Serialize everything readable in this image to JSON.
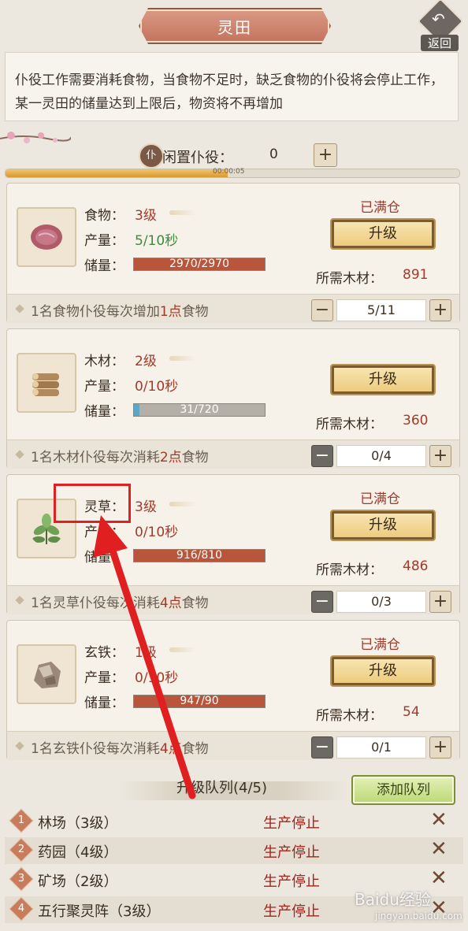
{
  "header": {
    "title": "灵田",
    "back_label": "返回"
  },
  "description": "仆役工作需要消耗食物，当食物不足时，缺乏食物的仆役将会停止工作，某一灵田的储量达到上限后，物资将不再增加",
  "idle": {
    "label": "闲置仆役：",
    "value": "0",
    "plus": "+",
    "icon_text": "仆",
    "timer": "00:00:05",
    "timer_progress": 0.49
  },
  "labels": {
    "rate": "产量：",
    "storage": "储量：",
    "cost": "所需木材：",
    "upgrade": "升级",
    "full": "已满仓",
    "minus": "−",
    "plus": "+"
  },
  "cards": [
    {
      "name": "食物：",
      "level": "3级",
      "rate": "5/10秒",
      "storage_text": "2970/2970",
      "storage_fill": 1.0,
      "full": true,
      "cost": "891",
      "footer_pre": "1名食物仆役每次增加",
      "footer_num": "1点",
      "footer_post": "食物",
      "count": "5/11",
      "icon": "meat-icon"
    },
    {
      "name": "木材：",
      "level": "2级",
      "rate": "0/10秒",
      "storage_text": "31/720",
      "storage_fill": 0.04,
      "full": false,
      "cost": "360",
      "footer_pre": "1名木材仆役每次消耗",
      "footer_num": "2点",
      "footer_post": "食物",
      "count": "0/4",
      "icon": "wood-logs-icon"
    },
    {
      "name": "灵草：",
      "level": "3级",
      "rate": "0/10秒",
      "storage_text": "916/810",
      "storage_fill": 1.0,
      "full": true,
      "cost": "486",
      "footer_pre": "1名灵草仆役每次消耗",
      "footer_num": "4点",
      "footer_post": "食物",
      "count": "0/3",
      "icon": "herb-icon"
    },
    {
      "name": "玄铁：",
      "level": "1级",
      "rate": "0/10秒",
      "storage_text": "947/90",
      "storage_fill": 1.0,
      "full": true,
      "cost": "54",
      "footer_pre": "1名玄铁仆役每次消耗",
      "footer_num": "4点",
      "footer_post": "食物",
      "count": "0/1",
      "icon": "ore-icon"
    }
  ],
  "queue": {
    "title": "升级队列(4/5)",
    "add_label": "添加队列",
    "items": [
      {
        "num": "1",
        "name": "林场（3级）",
        "status": "生产停止"
      },
      {
        "num": "2",
        "name": "药园（4级）",
        "status": "生产停止"
      },
      {
        "num": "3",
        "name": "矿场（2级）",
        "status": "生产停止"
      },
      {
        "num": "4",
        "name": "五行聚灵阵（3级）",
        "status": "生产停止"
      }
    ]
  },
  "watermark": {
    "main": "Baidu经验",
    "sub": "jingyan.baidu.com"
  },
  "colors": {
    "accent_red": "#a23a2a",
    "storage_fill": "#b8553a",
    "storage_low": "#5aa8c8",
    "rate_green": "#3f8a3a",
    "annotation": "#e02020"
  }
}
